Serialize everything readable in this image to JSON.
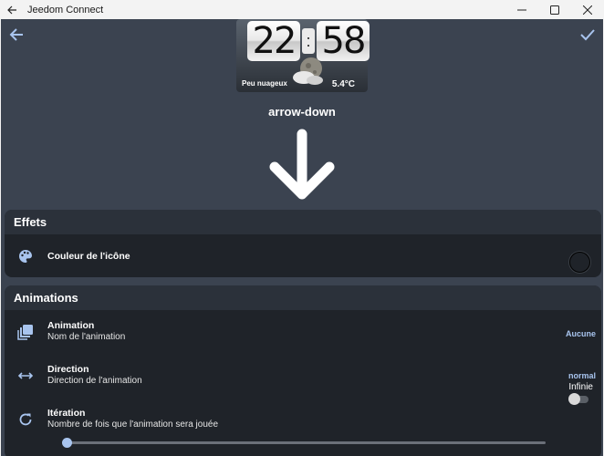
{
  "window": {
    "title": "Jeedom Connect"
  },
  "header": {
    "back_icon": "arrow-left-icon",
    "confirm_icon": "check-icon"
  },
  "widget": {
    "hour": "22",
    "colon": ":",
    "minute": "58",
    "condition": "Peu nuageux",
    "temperature": "5.4°C"
  },
  "preview": {
    "icon_name": "arrow-down"
  },
  "effects": {
    "title": "Effets",
    "color_label": "Couleur de l'icône"
  },
  "animations": {
    "title": "Animations",
    "animation": {
      "title": "Animation",
      "subtitle": "Nom de l'animation",
      "value": "Aucune"
    },
    "direction": {
      "title": "Direction",
      "subtitle": "Direction de l'animation",
      "value": "normal"
    },
    "iteration": {
      "title": "Itération",
      "subtitle": "Nombre de fois que l'animation sera jouée",
      "infinite_label": "Infinie",
      "infinite_enabled": false
    },
    "slider_value": 0
  },
  "colors": {
    "accent": "#a8c4ee",
    "background": "#3b4350",
    "card": "#1f2329"
  }
}
